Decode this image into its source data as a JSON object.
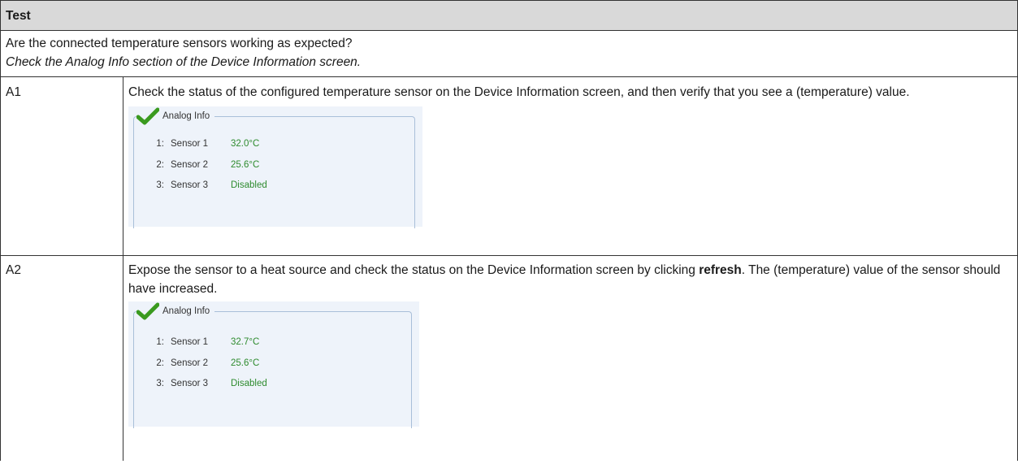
{
  "table": {
    "header": "Test",
    "question": "Are the connected temperature sensors working as expected?",
    "hint": "Check the Analog Info section of the Device Information screen.",
    "rows": [
      {
        "id": "A1",
        "text": "Check the status of the configured temperature sensor on the Device Information screen, and then verify that you see a (temperature) value.",
        "panel": {
          "title": "Analog Info",
          "sensors": [
            {
              "index": "1:",
              "name": "Sensor 1",
              "value": "32.0°C"
            },
            {
              "index": "2:",
              "name": "Sensor 2",
              "value": "25.6°C"
            },
            {
              "index": "3:",
              "name": "Sensor 3",
              "value": "Disabled"
            }
          ]
        }
      },
      {
        "id": "A2",
        "text_before": "Expose the sensor to a heat source and check the status on the Device Information screen by clicking ",
        "text_bold": "refresh",
        "text_after": ". The (temperature) value of the sensor should have increased.",
        "panel": {
          "title": "Analog Info",
          "sensors": [
            {
              "index": "1:",
              "name": "Sensor 1",
              "value": "32.7°C"
            },
            {
              "index": "2:",
              "name": "Sensor 2",
              "value": "25.6°C"
            },
            {
              "index": "3:",
              "name": "Sensor 3",
              "value": "Disabled"
            }
          ]
        }
      }
    ]
  },
  "colors": {
    "header_bg": "#d9d9d9",
    "value_green": "#2e8b2e",
    "check_green": "#3a9a1f",
    "panel_bg": "#eef3fa"
  },
  "icons": {
    "status": "checkmark-icon"
  }
}
